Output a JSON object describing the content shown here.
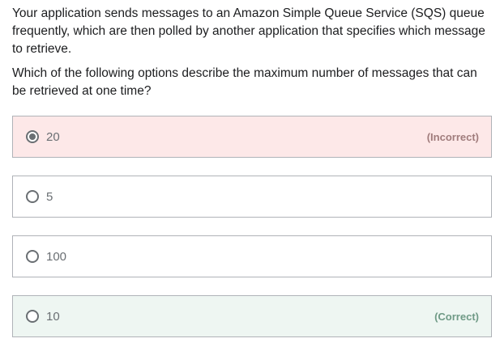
{
  "question": {
    "paragraph_1": "Your application sends messages to an Amazon Simple Queue Service (SQS) queue frequently, which are then polled by another application that specifies which message to retrieve.",
    "paragraph_2": "Which of the following options describe the maximum number of messages that can be retrieved at one time?"
  },
  "options": [
    {
      "label": "20",
      "selected": true,
      "verdict": "(Incorrect)",
      "state": "incorrect"
    },
    {
      "label": "5",
      "selected": false,
      "verdict": "",
      "state": "neutral"
    },
    {
      "label": "100",
      "selected": false,
      "verdict": "",
      "state": "neutral"
    },
    {
      "label": "10",
      "selected": false,
      "verdict": "(Correct)",
      "state": "correct"
    }
  ],
  "colors": {
    "incorrect_bg": "#fde8e8",
    "correct_bg": "#eef6f2",
    "incorrect_text": "#a07c7c",
    "correct_text": "#6f9a86",
    "border": "#b0b3b8"
  }
}
